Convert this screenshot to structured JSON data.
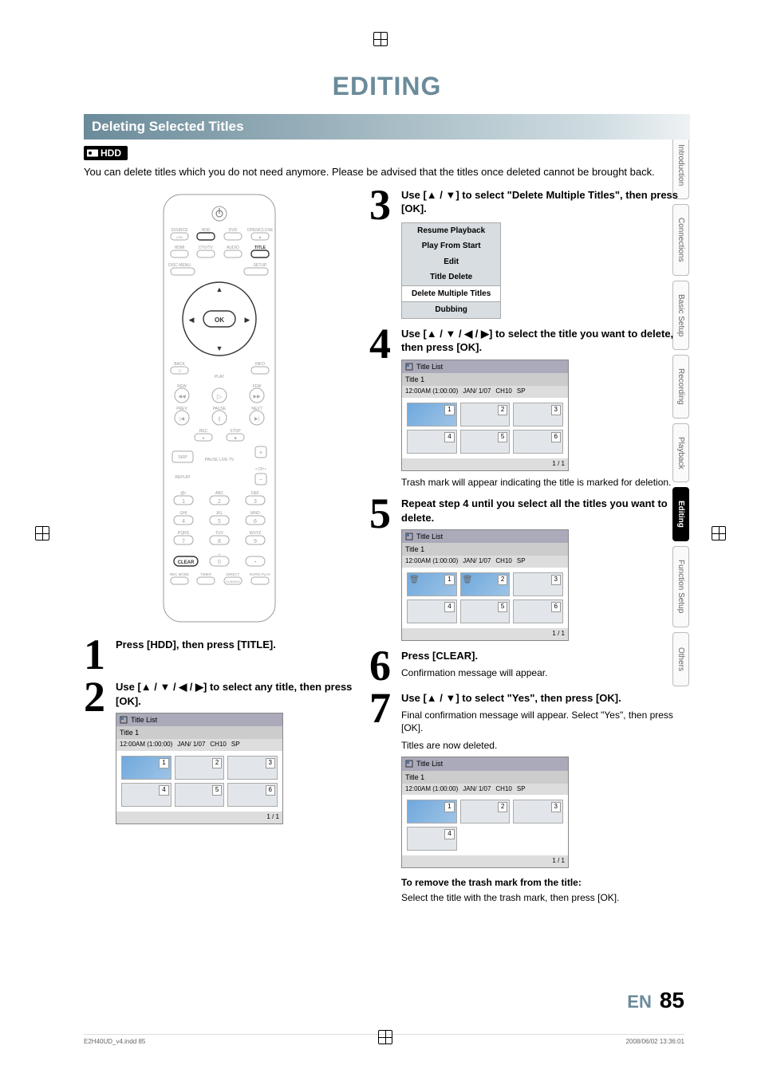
{
  "page": {
    "title": "EDITING",
    "section": "Deleting Selected Titles",
    "badge": "HDD",
    "intro": "You can delete titles which you do not need anymore. Please be advised that the titles once deleted cannot be brought back.",
    "lang": "EN",
    "pagenum": "85",
    "foot_file": "E2H40UD_v4.indd   85",
    "foot_time": "2008/06/02   13:36:01"
  },
  "tabs": [
    "Introduction",
    "Connections",
    "Basic Setup",
    "Recording",
    "Playback",
    "Editing",
    "Function Setup",
    "Others"
  ],
  "active_tab": "Editing",
  "remote_labels": {
    "row1": [
      "SOURCE",
      "HDD",
      "DVD",
      "OPEN/CLOSE"
    ],
    "row2": [
      "HDMI",
      "DTV/TV",
      "AUDIO",
      "TITLE"
    ],
    "row3l": "DISC MENU",
    "row3r": "SETUP",
    "ok": "OK",
    "back": "BACK",
    "info": "INFO",
    "play": "PLAY",
    "rew": "REW",
    "ffw": "FFW",
    "prev": "PREV",
    "pause": "PAUSE",
    "next": "NEXT",
    "rec": "REC",
    "stop": "STOP",
    "skip": "SKIP",
    "pauselive": "PAUSE LIVE TV",
    "replay": "REPLAY",
    "ch": "• CH •",
    "num": [
      [
        "@/:",
        "ABC",
        "DEF"
      ],
      [
        "GHI",
        "JKL",
        "MNO"
      ],
      [
        "PQRS",
        "TUV",
        "WXYZ"
      ]
    ],
    "digits": [
      [
        "1",
        "2",
        "3"
      ],
      [
        "4",
        "5",
        "6"
      ],
      [
        "7",
        "8",
        "9"
      ]
    ],
    "clear": "CLEAR",
    "zero": "0",
    "bottom": [
      "REC MODE",
      "TIMER",
      "DIRECT",
      "RAPID PLAY"
    ],
    "dubbing": "DUBBING"
  },
  "title_list": {
    "header": "Title List",
    "subtitle": "Title 1",
    "time": "12:00AM (1:00:00)",
    "date": "JAN/  1/07",
    "ch": "CH10",
    "mode": "SP",
    "page": "1 / 1"
  },
  "menu": [
    "Resume Playback",
    "Play From Start",
    "Edit",
    "Title Delete",
    "Delete Multiple Titles",
    "Dubbing"
  ],
  "menu_selected": "Delete Multiple Titles",
  "steps": {
    "1": {
      "title": "Press [HDD], then press [TITLE]."
    },
    "2": {
      "title": "Use [▲ / ▼ / ◀ / ▶] to select any title, then press [OK]."
    },
    "3": {
      "title": "Use [▲ / ▼] to select \"Delete Multiple Titles\", then press [OK]."
    },
    "4": {
      "title": "Use [▲ / ▼ / ◀ / ▶] to select the title you want to delete, then press [OK].",
      "note": "Trash mark will appear indicating the title is marked for deletion."
    },
    "5": {
      "title": "Repeat step 4 until you select all the titles you want to delete."
    },
    "6": {
      "title": "Press [CLEAR].",
      "body": "Confirmation message will appear."
    },
    "7": {
      "title": "Use [▲ / ▼] to select \"Yes\", then press [OK].",
      "body": "Final confirmation message will appear. Select \"Yes\", then press [OK].",
      "note": "Titles are now deleted."
    }
  },
  "footer_note": {
    "heading": "To remove the trash mark from the title:",
    "body": "Select the title with the trash mark, then press [OK]."
  }
}
